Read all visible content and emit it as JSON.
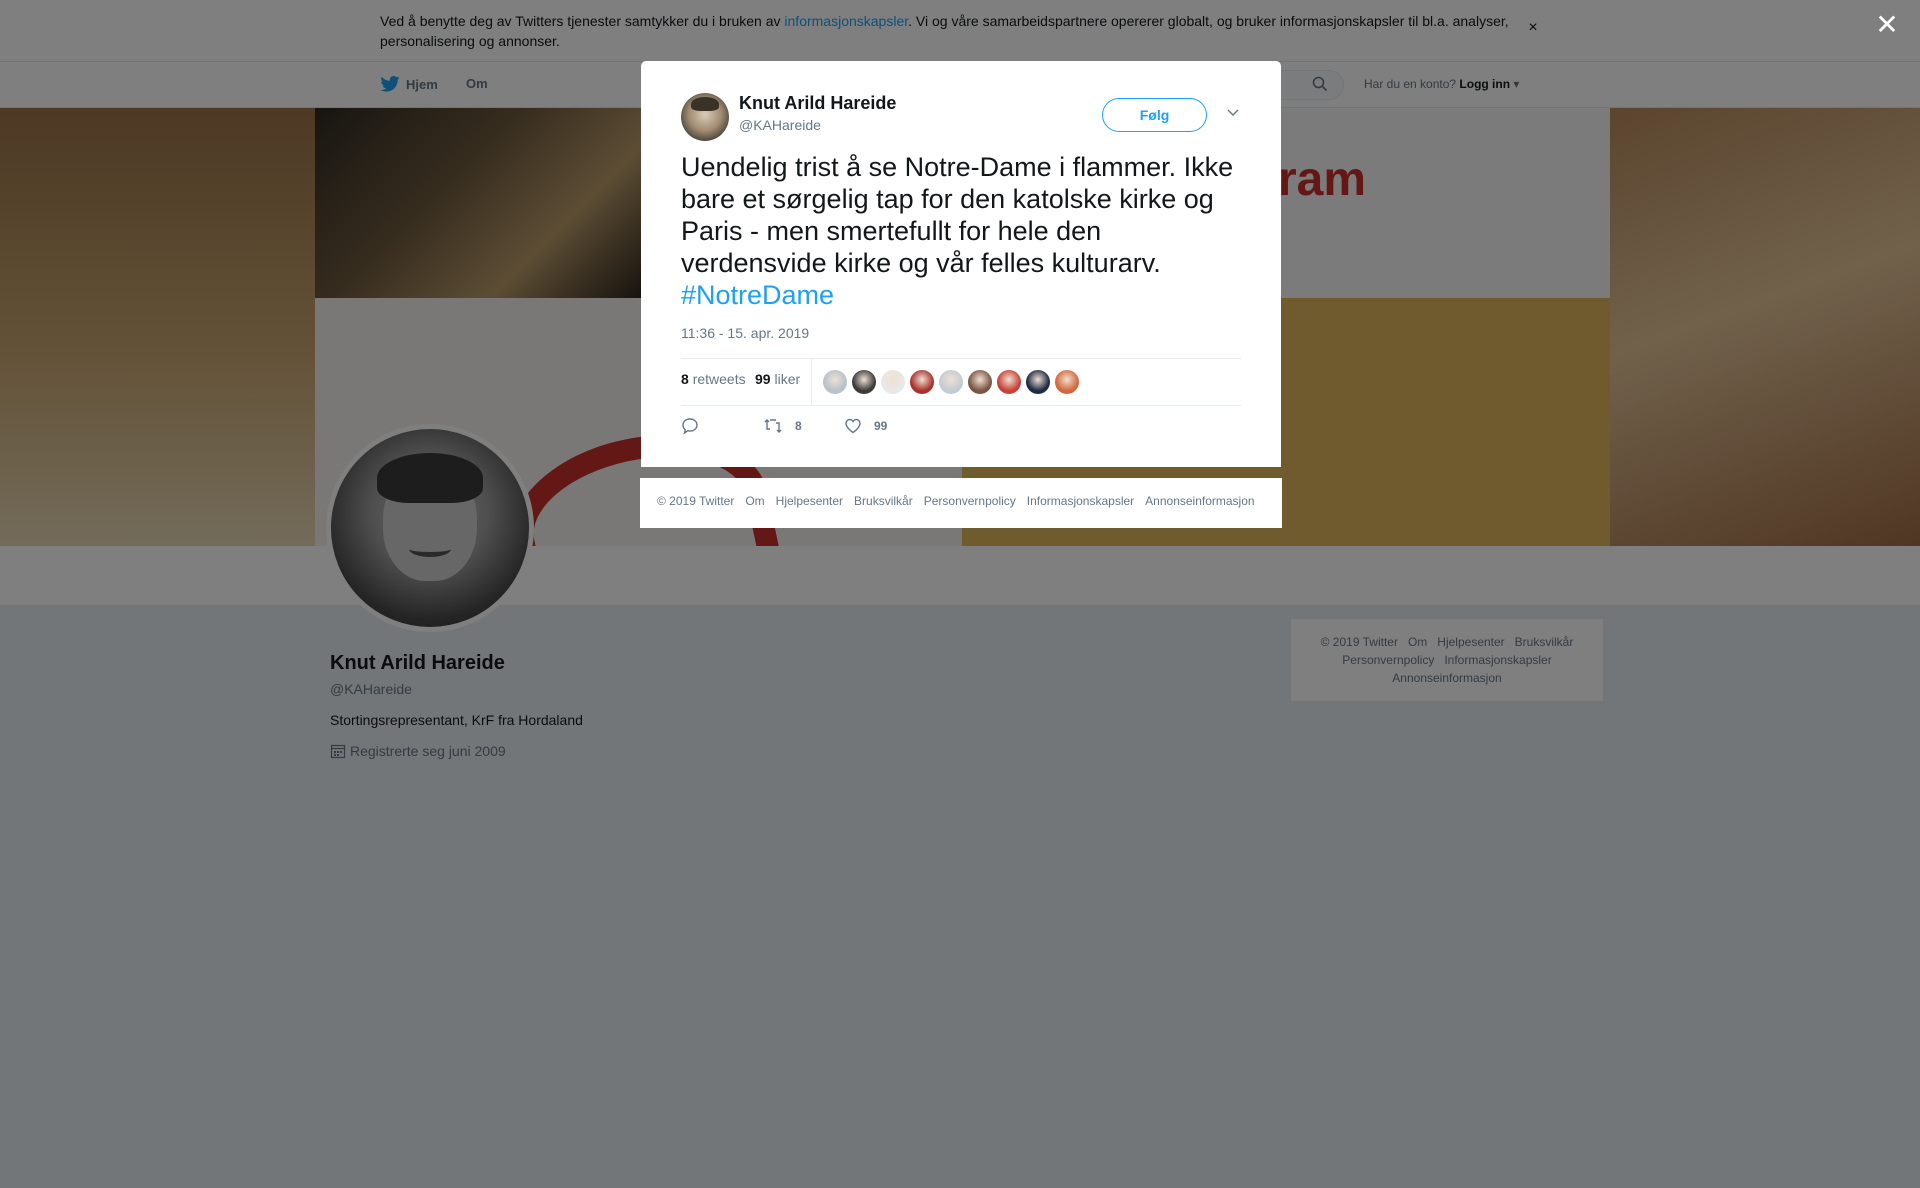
{
  "consent": {
    "text_before": "Ved å benytte deg av Twitters tjenester samtykker du i bruken av ",
    "link": "informasjonskapsler",
    "text_after": ". Vi og våre samarbeidspartnere opererer globalt, og bruker informasjonskapsler til bl.a. analyser, personalisering og annonser.",
    "close": "×"
  },
  "nav": {
    "home": "Hjem",
    "about": "Om",
    "login_prompt": "Har du en konto?",
    "login": "Logg inn"
  },
  "profile": {
    "name": "Knut Arild Hareide",
    "handle": "@KAHareide",
    "bio": "Stortingsrepresentant, KrF fra Hordaland",
    "joined": "Registrerte seg juni 2009"
  },
  "side_footer": {
    "row1": [
      "© 2019 Twitter",
      "Om",
      "Hjelpesenter",
      "Bruksvilkår"
    ],
    "row2": [
      "Personvernpolicy",
      "Informasjonskapsler"
    ],
    "row3": [
      "Annonseinformasjon"
    ]
  },
  "overlay": {
    "close": "✕"
  },
  "tweet": {
    "author_name": "Knut Arild Hareide",
    "author_handle": "@KAHareide",
    "follow": "Følg",
    "text": "Uendelig trist å se Notre-Dame i flammer. Ikke bare et sørgelig tap for den katolske kirke og Paris - men smertefullt for hele den verdensvide kirke og vår felles kulturarv. ",
    "hashtag": "#NotreDame",
    "timestamp": "11:36 - 15. apr. 2019",
    "retweets_count": "8",
    "retweets_label": "retweets",
    "likes_count": "99",
    "likes_label": "liker",
    "reply_count": "",
    "retweet_action_count": "8",
    "like_action_count": "99",
    "liker_colors": [
      "#b8c2cc",
      "#3b3b3b",
      "#e8e8e8",
      "#a8322e",
      "#c3ccd4",
      "#7a5544",
      "#c8403a",
      "#1f2a44",
      "#d2683f"
    ]
  },
  "modal_footer": {
    "links": [
      "© 2019 Twitter",
      "Om",
      "Hjelpesenter",
      "Bruksvilkår",
      "Personvernpolicy",
      "Informasjonskapsler",
      "Annonseinformasjon"
    ]
  },
  "colors": {
    "accent": "#1da1f2",
    "text": "#14171a",
    "muted": "#657786"
  }
}
